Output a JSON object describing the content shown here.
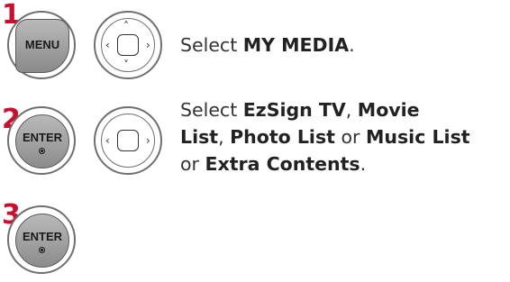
{
  "steps": [
    {
      "number": "1",
      "key_label": "MENU",
      "text_prefix": "Select ",
      "items": [
        "MY MEDIA"
      ],
      "text_suffix": "."
    },
    {
      "number": "2",
      "key_label": "ENTER",
      "line1_prefix": "Select ",
      "item1": "EzSign TV",
      "sep1": ", ",
      "item2": "Movie",
      "item3": "List",
      "sep2": ", ",
      "item4": "Photo List",
      "sep3": " or ",
      "item5": "Music List",
      "line3_prefix": "or ",
      "item6": "Extra Contents",
      "line3_suffix": "."
    },
    {
      "number": "3",
      "key_label": "ENTER"
    }
  ],
  "icons": {
    "nav_up": "up-arrow-icon",
    "nav_down": "down-arrow-icon",
    "nav_left": "left-arrow-icon",
    "nav_right": "right-arrow-icon"
  }
}
